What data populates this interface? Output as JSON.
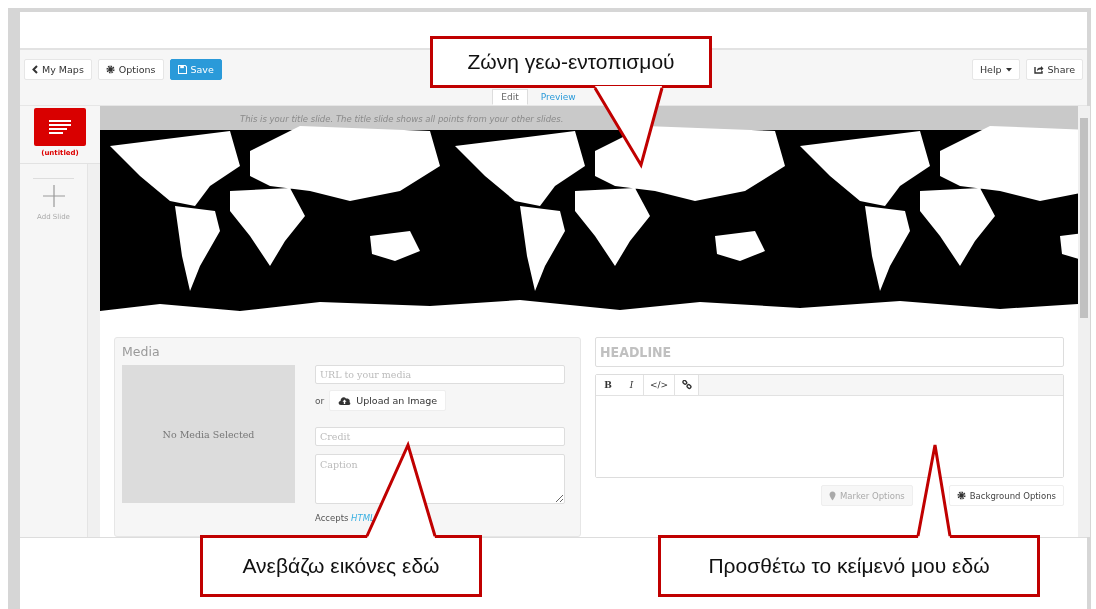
{
  "toolbar": {
    "left_buttons": [
      {
        "label": "My Maps",
        "kind": "back"
      },
      {
        "label": "Options",
        "kind": "options"
      },
      {
        "label": "Save",
        "kind": "save"
      }
    ],
    "right_buttons": [
      {
        "label": "Help",
        "kind": "help"
      },
      {
        "label": "Share",
        "kind": "share"
      }
    ]
  },
  "tabs": [
    {
      "label": "Edit",
      "selected": true
    },
    {
      "label": "Preview",
      "selected": false
    }
  ],
  "slides": [
    {
      "label": "(untitled)",
      "selected": true
    }
  ],
  "add_slide": "Add Slide",
  "map": {
    "note": "This is your title slide. The title slide shows all points from your other slides."
  },
  "media": {
    "title": "Media",
    "empty": "No Media Selected",
    "url_placeholder": "URL to your media",
    "or": "or",
    "upload": "Upload an Image",
    "credit_placeholder": "Credit",
    "caption_placeholder": "Caption",
    "accepts": "Accepts",
    "accepts_link": "HTML"
  },
  "text": {
    "headline_placeholder": "HEADLINE",
    "format_buttons": [
      {
        "kind": "bold",
        "label": "B"
      },
      {
        "kind": "italic",
        "label": "I"
      },
      {
        "kind": "code",
        "label": "</>"
      },
      {
        "kind": "link"
      }
    ],
    "buttons": [
      {
        "label": "Marker Options",
        "kind": "marker",
        "disabled": true
      },
      {
        "label": "Background Options",
        "kind": "background",
        "disabled": false
      }
    ]
  },
  "callouts": [
    {
      "text": "Ζώνη γεω-εντοπισμού"
    },
    {
      "text": "Ανεβάζω εικόνες εδώ"
    },
    {
      "text": "Προσθέτω το κείμενό μου εδώ"
    }
  ]
}
